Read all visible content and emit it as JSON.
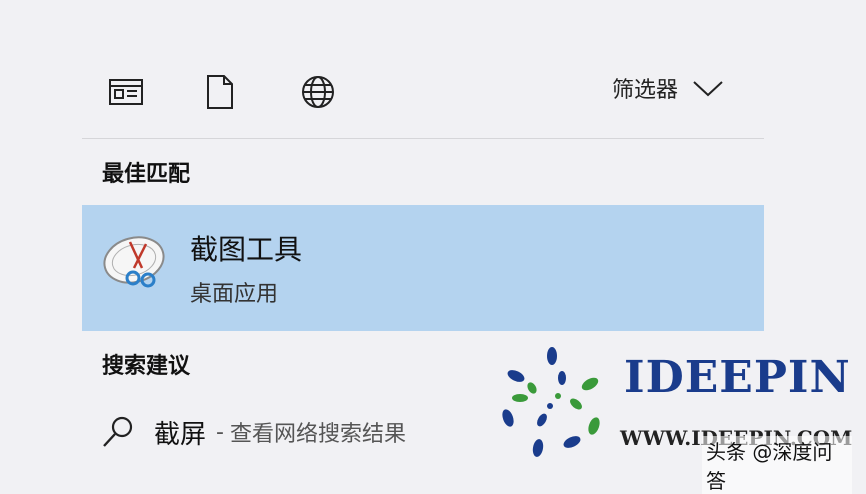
{
  "toolbar": {
    "icons": [
      "news-icon",
      "document-icon",
      "globe-icon"
    ],
    "filter_label": "筛选器"
  },
  "best_match": {
    "heading": "最佳匹配",
    "app_name": "截图工具",
    "app_type": "桌面应用"
  },
  "suggestions": {
    "heading": "搜索建议",
    "items": [
      {
        "query": "截屏",
        "separator": "-",
        "description": "查看网络搜索结果"
      }
    ]
  },
  "watermark": {
    "brand": "IDEEPIN",
    "url": "WWW.IDEEPIN.COM",
    "credit": "头条 @深度问答"
  },
  "colors": {
    "background": "#f1f1f4",
    "highlight": "#b4d3ef",
    "brand_blue": "#1a3c8c",
    "brand_green": "#3a9a3a"
  }
}
